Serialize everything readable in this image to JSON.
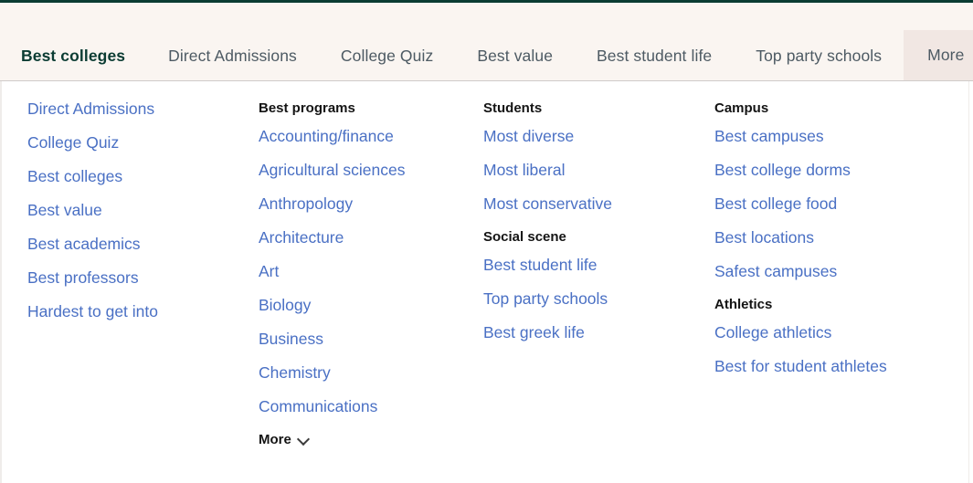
{
  "top_bar": {
    "accent_color": "#0b3c33"
  },
  "colors": {
    "tabbar_background": "#faf5f1",
    "more_tab_background": "#f1e7e3",
    "active_tab": "#0b3c33",
    "inactive_tab": "#4d5a63",
    "link_blue": "#4a70c4",
    "heading_black": "#141414",
    "panel_background": "#ffffff"
  },
  "tabbar": {
    "tabs": [
      {
        "label": "Best colleges",
        "active": true
      },
      {
        "label": "Direct Admissions",
        "active": false
      },
      {
        "label": "College Quiz",
        "active": false
      },
      {
        "label": "Best value",
        "active": false
      },
      {
        "label": "Best student life",
        "active": false
      },
      {
        "label": "Top party schools",
        "active": false
      }
    ],
    "more_tab": {
      "label": "More",
      "icon": "chevron-up-icon",
      "expanded": true
    }
  },
  "panel": {
    "columns": [
      {
        "groups": [
          {
            "heading": null,
            "links": [
              "Direct Admissions",
              "College Quiz",
              "Best colleges",
              "Best value",
              "Best academics",
              "Best professors",
              "Hardest to get into"
            ]
          }
        ]
      },
      {
        "groups": [
          {
            "heading": "Best programs",
            "links": [
              "Accounting/finance",
              "Agricultural sciences",
              "Anthropology",
              "Architecture",
              "Art",
              "Biology",
              "Business",
              "Chemistry",
              "Communications"
            ],
            "more": {
              "label": "More",
              "icon": "chevron-down-icon"
            }
          }
        ]
      },
      {
        "groups": [
          {
            "heading": "Students",
            "links": [
              "Most diverse",
              "Most liberal",
              "Most conservative"
            ]
          },
          {
            "heading": "Social scene",
            "links": [
              "Best student life",
              "Top party schools",
              "Best greek life"
            ]
          }
        ]
      },
      {
        "groups": [
          {
            "heading": "Campus",
            "links": [
              "Best campuses",
              "Best college dorms",
              "Best college food",
              "Best locations",
              "Safest campuses"
            ]
          },
          {
            "heading": "Athletics",
            "links": [
              "College athletics",
              "Best for student athletes"
            ]
          }
        ]
      }
    ]
  }
}
